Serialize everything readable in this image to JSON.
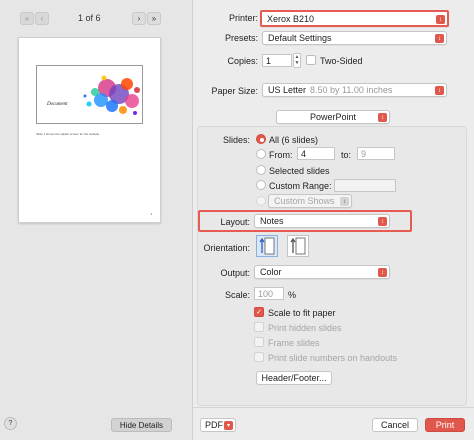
{
  "preview": {
    "page_indicator": "1 of 6",
    "slide_title": "Document",
    "notes_text": "Slide 1 shows the splash screen for the website",
    "page_number": "4",
    "hide_details_label": "Hide Details",
    "help_label": "?"
  },
  "settings": {
    "printer_label": "Printer:",
    "printer_value": "Xerox B210",
    "presets_label": "Presets:",
    "presets_value": "Default Settings",
    "copies_label": "Copies:",
    "copies_value": "1",
    "two_sided_label": "Two-Sided",
    "paper_size_label": "Paper Size:",
    "paper_size_value": "US Letter",
    "paper_size_dims": "8.50 by 11.00 inches",
    "app_section": "PowerPoint",
    "slides_label": "Slides:",
    "slides_all": "All  (6 slides)",
    "from_label": "From:",
    "from_value": "4",
    "to_label": "to:",
    "to_value": "9",
    "selected_slides": "Selected slides",
    "custom_range": "Custom Range:",
    "custom_shows": "Custom Shows",
    "layout_label": "Layout:",
    "layout_value": "Notes",
    "orientation_label": "Orientation:",
    "output_label": "Output:",
    "output_value": "Color",
    "scale_label": "Scale:",
    "scale_value": "100",
    "scale_unit": "%",
    "scale_to_fit": "Scale to fit paper",
    "print_hidden": "Print hidden slides",
    "frame_slides": "Frame slides",
    "print_slide_numbers": "Print slide numbers on handouts",
    "header_footer_label": "Header/Footer..."
  },
  "footer": {
    "pdf_label": "PDF",
    "cancel_label": "Cancel",
    "print_label": "Print"
  },
  "colors": {
    "accent": "#e0574c",
    "highlight_border": "#e65b52"
  }
}
